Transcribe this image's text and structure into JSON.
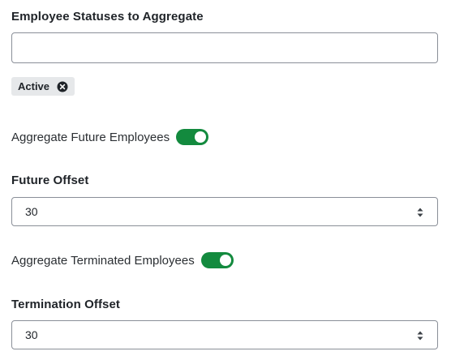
{
  "statuses": {
    "label": "Employee Statuses to Aggregate",
    "input_value": "",
    "chips": [
      {
        "label": "Active",
        "remove_icon": "close-circle-icon"
      }
    ]
  },
  "future_toggle": {
    "label": "Aggregate Future Employees",
    "checked": true
  },
  "future_offset": {
    "label": "Future Offset",
    "value": "30"
  },
  "terminated_toggle": {
    "label": "Aggregate Terminated Employees",
    "checked": true
  },
  "termination_offset": {
    "label": "Termination Offset",
    "value": "30"
  },
  "colors": {
    "toggle_on": "#138a3e",
    "chip_bg": "#e6e8ea",
    "border": "#8a8f98"
  }
}
